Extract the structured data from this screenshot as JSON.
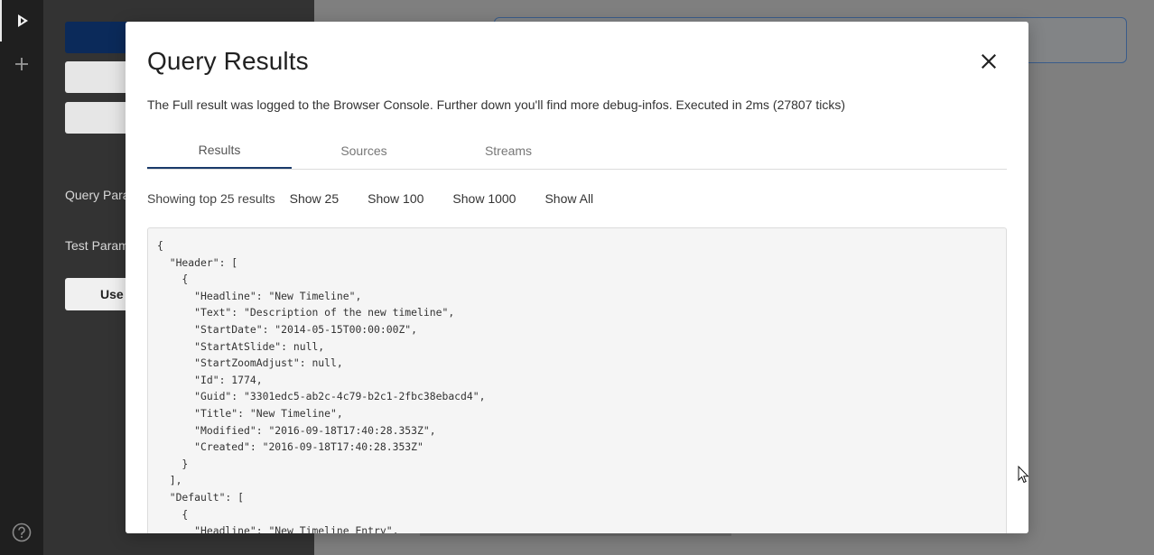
{
  "background": {
    "sidebar_labels": {
      "query_params": "Query Para",
      "test_params": "Test Param",
      "use_button": "Use"
    }
  },
  "modal": {
    "title": "Query Results",
    "description": "The Full result was logged to the Browser Console. Further down you'll find more debug-infos. Executed in 2ms (27807 ticks)",
    "tabs": [
      {
        "label": "Results",
        "active": true
      },
      {
        "label": "Sources",
        "active": false
      },
      {
        "label": "Streams",
        "active": false
      }
    ],
    "showing_text": "Showing top 25 results",
    "show_options": [
      "Show 25",
      "Show 100",
      "Show 1000",
      "Show All"
    ],
    "result_json": "{\n  \"Header\": [\n    {\n      \"Headline\": \"New Timeline\",\n      \"Text\": \"Description of the new timeline\",\n      \"StartDate\": \"2014-05-15T00:00:00Z\",\n      \"StartAtSlide\": null,\n      \"StartZoomAdjust\": null,\n      \"Id\": 1774,\n      \"Guid\": \"3301edc5-ab2c-4c79-b2c1-2fbc38ebacd4\",\n      \"Title\": \"New Timeline\",\n      \"Modified\": \"2016-09-18T17:40:28.353Z\",\n      \"Created\": \"2016-09-18T17:40:28.353Z\"\n    }\n  ],\n  \"Default\": [\n    {\n      \"Headline\": \"New Timeline Entry\","
  },
  "icons": {
    "rail_run": "play-icon",
    "rail_add": "plus-icon",
    "rail_help": "help-icon",
    "modal_close": "close-icon",
    "pointer": "mouse-cursor-icon"
  },
  "colors": {
    "primary_button": "#0b2a5a",
    "active_tab_underline": "#1a3a6b",
    "rail_background": "#1f1f1f",
    "overlay": "#7f7f7f"
  }
}
